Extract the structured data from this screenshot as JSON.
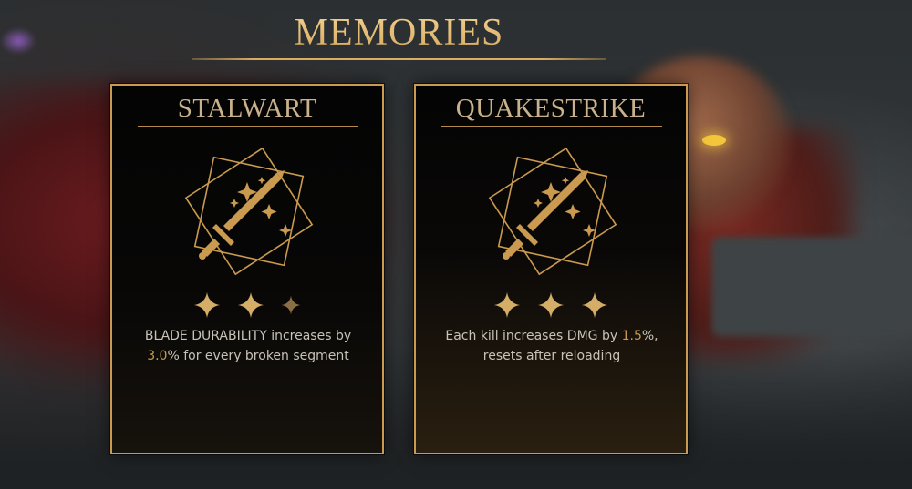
{
  "header": {
    "title": "MEMORIES"
  },
  "cards": [
    {
      "name": "STALWART",
      "icon": "sword-sparkles-icon",
      "stars_filled": 2,
      "stars_total": 3,
      "desc_before": "BLADE DURABILITY increases by ",
      "desc_value": "3.0",
      "desc_after": "% for every broken segment"
    },
    {
      "name": "QUAKESTRIKE",
      "icon": "sword-sparkles-icon",
      "stars_filled": 3,
      "stars_total": 3,
      "desc_before": "Each kill increases DMG by ",
      "desc_value": "1.5",
      "desc_after": "%, resets after reloading"
    }
  ],
  "colors": {
    "gold": "#c99a4f",
    "title_gold": "#e9c27a",
    "text": "#c8c3b8"
  }
}
